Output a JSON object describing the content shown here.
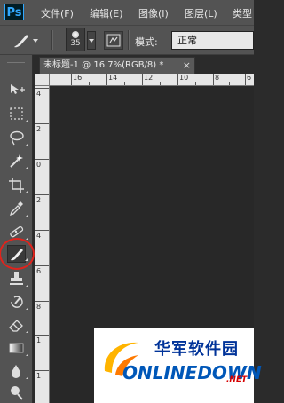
{
  "app": {
    "logo": "Ps"
  },
  "menu": [
    "文件(F)",
    "编辑(E)",
    "图像(I)",
    "图层(L)",
    "类型"
  ],
  "options": {
    "brush_size": "35",
    "mode_label": "模式:",
    "mode_value": "正常"
  },
  "document": {
    "tab_title": "未标题-1 @ 16.7%(RGB/8) *",
    "close": "×"
  },
  "ruler": {
    "h_labels": [
      "16",
      "14",
      "12",
      "10",
      "8",
      "6"
    ],
    "v_labels": [
      "4",
      "2",
      "0",
      "2",
      "4",
      "6",
      "8",
      "1",
      "1"
    ]
  },
  "tools": [
    "move-icon",
    "marquee-icon",
    "lasso-icon",
    "magic-wand-icon",
    "crop-icon",
    "eyedropper-icon",
    "healing-brush-icon",
    "brush-icon",
    "clone-stamp-icon",
    "history-brush-icon",
    "eraser-icon",
    "gradient-icon",
    "blur-icon",
    "dodge-icon"
  ],
  "selected_tool": "brush-icon",
  "watermark": {
    "text_cn": "华军软件园",
    "text_en": "ONLINEDOWN",
    "suffix": ".NET"
  },
  "colors": {
    "ui": "#535353",
    "canvas": "#282828",
    "highlight": "#e0231c",
    "ps_blue": "#31a8ff"
  }
}
